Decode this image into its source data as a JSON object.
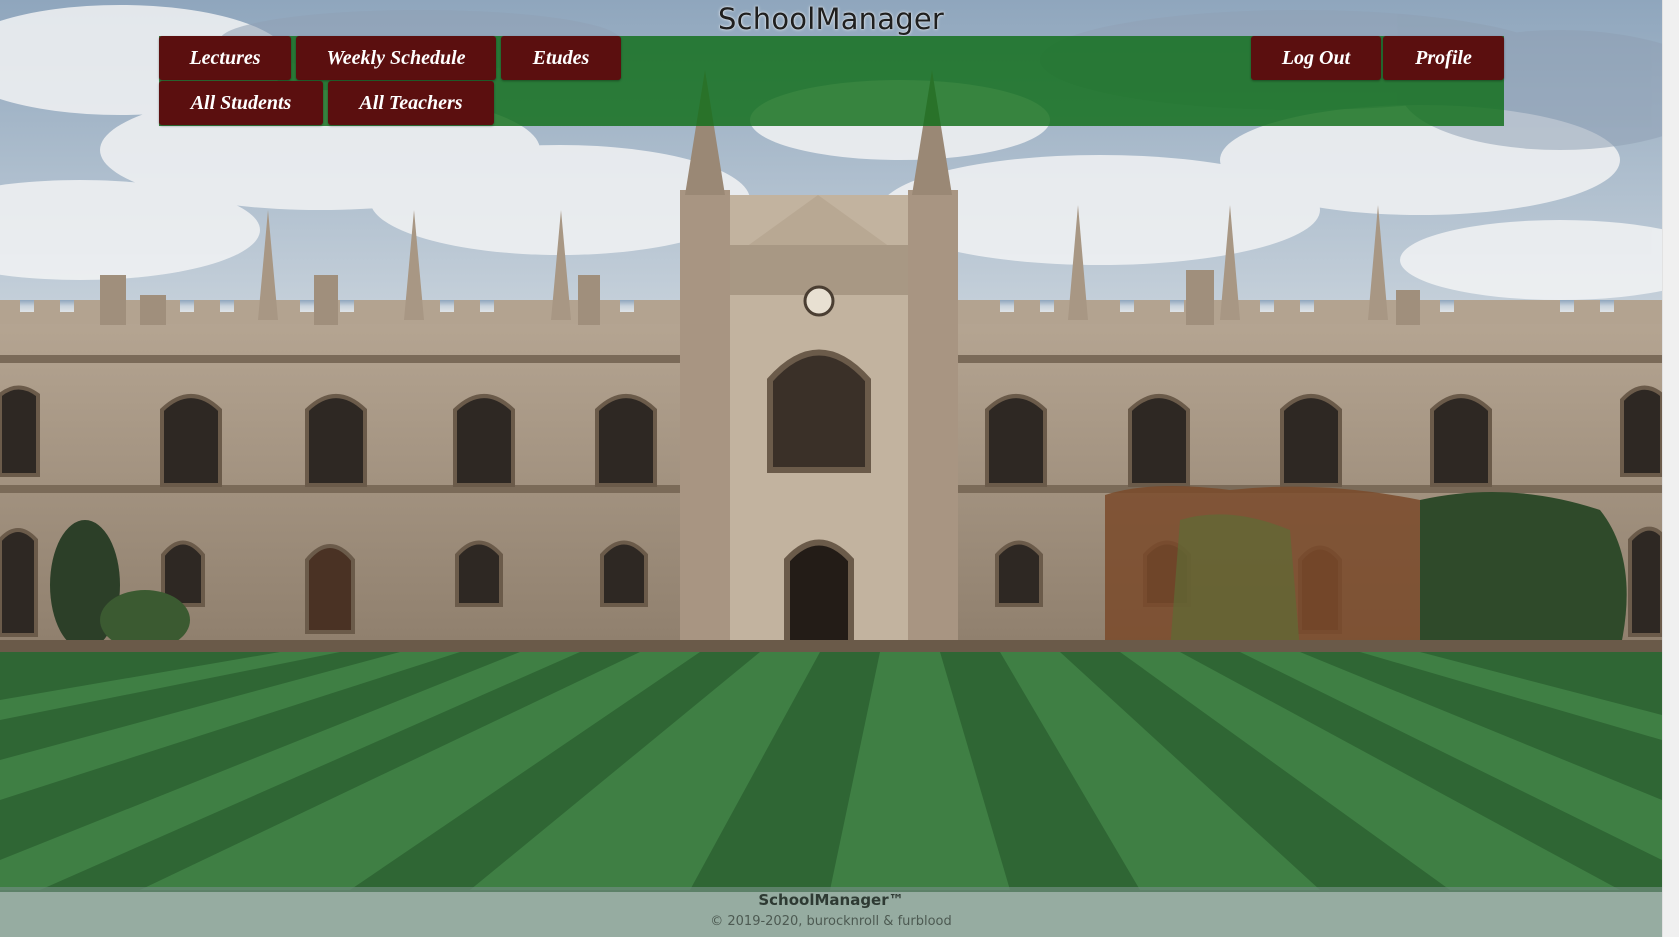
{
  "site": {
    "title": "SchoolManager"
  },
  "nav": {
    "row1_left": [
      {
        "label": "Lectures"
      },
      {
        "label": "Weekly Schedule"
      },
      {
        "label": "Etudes"
      }
    ],
    "row1_right": [
      {
        "label": "Log Out"
      },
      {
        "label": "Profile"
      }
    ],
    "row2_left": [
      {
        "label": "All Students"
      },
      {
        "label": "All Teachers"
      }
    ]
  },
  "footer": {
    "brand": "SchoolManager™",
    "copyright": "© 2019-2020, burocknroll & furblood"
  },
  "colors": {
    "nav_bar": "#106e18",
    "nav_button": "#5b0f0f",
    "nav_button_text": "#ffffff",
    "footer_bg": "#6e8c7d"
  },
  "background": {
    "description_icon": "college-building-photo"
  }
}
